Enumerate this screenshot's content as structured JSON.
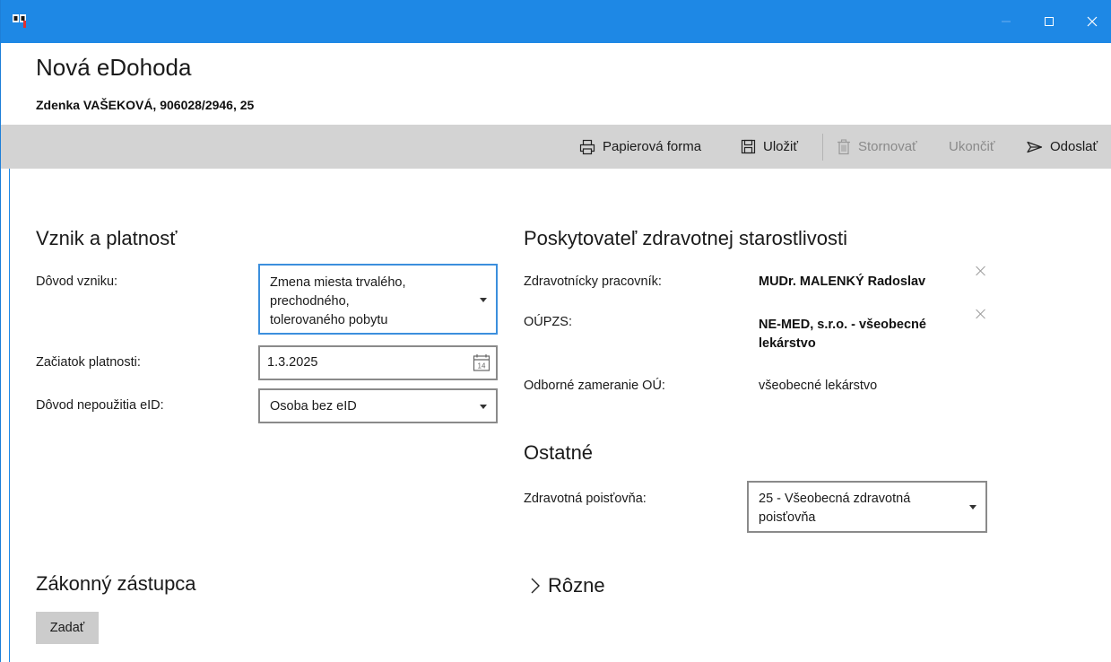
{
  "window": {
    "app_icon": "app-logo-icon",
    "controls": {
      "minimize": "—",
      "maximize": "☐",
      "close": "✕"
    }
  },
  "header": {
    "title": "Nová eDohoda",
    "patient": "Zdenka VAŠEKOVÁ, 906028/2946, 25"
  },
  "toolbar": {
    "paper_form": "Papierová forma",
    "save": "Uložiť",
    "cancel": "Stornovať",
    "finish": "Ukončiť",
    "send": "Odoslať"
  },
  "vznik": {
    "title": "Vznik a platnosť",
    "reason_label": "Dôvod vzniku:",
    "reason_value_lines": [
      "Zmena miesta trvalého,",
      "prechodného,",
      "tolerovaného pobytu"
    ],
    "start_label": "Začiatok platnosti:",
    "start_value": "1.3.2025",
    "calendar_day": "14",
    "eid_label": "Dôvod nepoužitia eID:",
    "eid_value": "Osoba bez eID"
  },
  "provider": {
    "title": "Poskytovateľ zdravotnej starostlivosti",
    "worker_label": "Zdravotnícky pracovník:",
    "worker_value": "MUDr. MALENKÝ Radoslav",
    "oupzs_label": "OÚPZS:",
    "oupzs_value_lines": [
      "NE-MED, s.r.o. - všeobecné",
      "lekárstvo"
    ],
    "focus_label": "Odborné zameranie OÚ:",
    "focus_value": "všeobecné lekárstvo"
  },
  "other": {
    "title": "Ostatné",
    "insurer_label": "Zdravotná poisťovňa:",
    "insurer_value_lines": [
      "25 - Všeobecná zdravotná",
      "poisťovňa"
    ]
  },
  "guardian": {
    "title": "Zákonný zástupca",
    "add_button": "Zadať"
  },
  "misc": {
    "expander_label": "Rôzne"
  }
}
